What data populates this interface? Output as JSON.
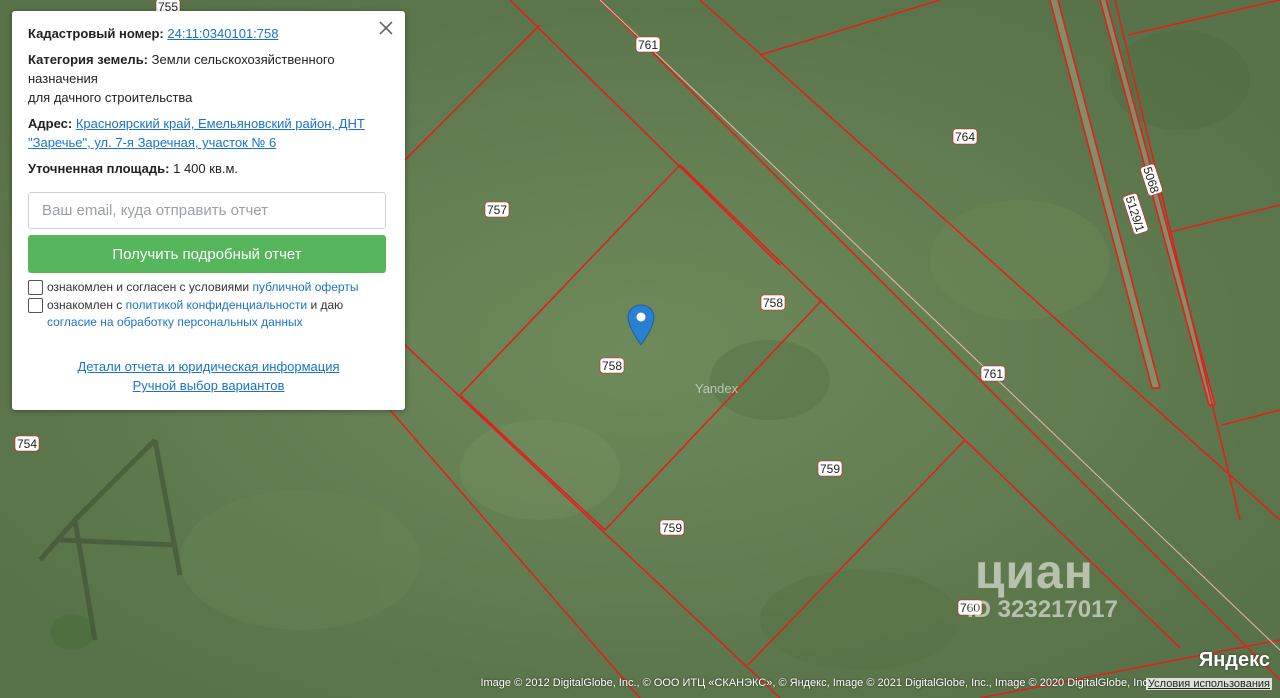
{
  "card": {
    "cadastral_label": "Кадастровый номер:",
    "cadastral_number": "24:11:0340101:758",
    "category_label": "Категория земель:",
    "category_value_line1": "Земли сельскохозяйственного назначения",
    "category_value_line2": "для дачного строительства",
    "address_label": "Адрес:",
    "address_value": "Красноярский край, Емельяновский район, ДНТ \"Заречье\", ул. 7-я Заречная, участок № 6",
    "area_label": "Уточненная площадь:",
    "area_value": "1 400 кв.м.",
    "email_placeholder": "Ваш email, куда отправить отчет",
    "email_value": "",
    "submit_label": "Получить подробный отчет",
    "consent1_text": "ознакомлен и согласен с условиями",
    "consent1_link": "публичной оферты",
    "consent2_text": "ознакомлен с",
    "consent2_link1": "политикой конфиденциальности",
    "consent2_mid": "и даю",
    "consent2_link2": "согласие на обработку персональных данных",
    "details_link": "Детали отчета и юридическая информация",
    "manual_link": "Ручной выбор вариантов"
  },
  "map": {
    "plot_labels": [
      "755",
      "761",
      "764",
      "5068",
      "5129/1",
      "757",
      "758",
      "758",
      "761",
      "754",
      "759",
      "759",
      "760"
    ],
    "watermark": "Yandex",
    "cian_brand": "циан",
    "cian_id": "ID 323217017",
    "attribution": "Image © 2012 DigitalGlobe, Inc., © ООО ИТЦ «СКАНЭКС», © Яндекс, Image © 2021 DigitalGlobe, Inc., Image © 2020 DigitalGlobe, Inc.",
    "terms_link": "Условия использования",
    "logo": "Яндекс",
    "colors": {
      "boundary": "#e02020",
      "terrain": "#5f7b4e",
      "pin": "#2b7fd1",
      "button": "#56b65c",
      "link": "#1a73c8"
    }
  }
}
